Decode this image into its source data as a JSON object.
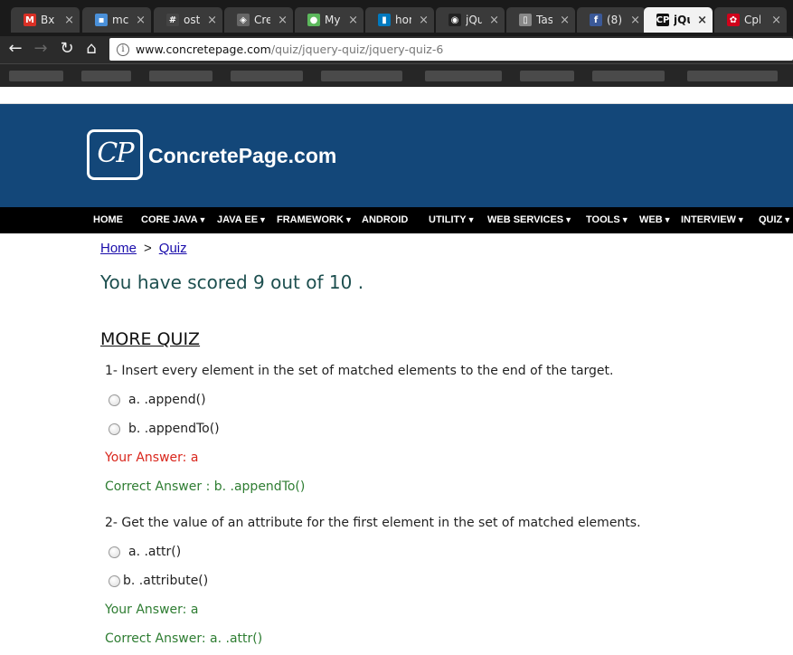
{
  "browser": {
    "tabs": [
      {
        "label": "Bx",
        "favicon": "gmail-icon",
        "color": "#d93025",
        "glyph": "M"
      },
      {
        "label": "mc",
        "favicon": "folder-icon",
        "color": "#4a90d9",
        "glyph": "▪"
      },
      {
        "label": "ost",
        "favicon": "slack-icon",
        "color": "#444444",
        "glyph": "#"
      },
      {
        "label": "Cre",
        "favicon": "cube-icon",
        "color": "#666666",
        "glyph": "◈"
      },
      {
        "label": "My",
        "favicon": "circle-icon",
        "color": "#5cb85c",
        "glyph": "●"
      },
      {
        "label": "hor",
        "favicon": "trello-icon",
        "color": "#0079bf",
        "glyph": "▮"
      },
      {
        "label": "jQu",
        "favicon": "github-icon",
        "color": "#222222",
        "glyph": "◉"
      },
      {
        "label": "Tas",
        "favicon": "document-icon",
        "color": "#888888",
        "glyph": "▯"
      },
      {
        "label": "(8)",
        "favicon": "facebook-icon",
        "color": "#3b5998",
        "glyph": "f"
      },
      {
        "label": "jQu",
        "favicon": "concretepage-icon",
        "color": "#111111",
        "glyph": "CP"
      },
      {
        "label": "Cpl",
        "favicon": "red-badge-icon",
        "color": "#d0021b",
        "glyph": "✿"
      }
    ],
    "active_tab_index": 9,
    "url_host": "www.concretepage.com",
    "url_path": "/quiz/jquery-quiz/jquery-quiz-6"
  },
  "site": {
    "logo_mark": "CP",
    "logo_text": "ConcretePage.com",
    "header_color": "#134779",
    "nav": [
      {
        "label": "HOME",
        "dropdown": false
      },
      {
        "label": "CORE JAVA",
        "dropdown": true
      },
      {
        "label": "JAVA EE",
        "dropdown": true
      },
      {
        "label": "FRAMEWORK",
        "dropdown": true
      },
      {
        "label": "ANDROID",
        "dropdown": false
      },
      {
        "label": "UTILITY",
        "dropdown": true
      },
      {
        "label": "WEB SERVICES",
        "dropdown": true
      },
      {
        "label": "TOOLS",
        "dropdown": true
      },
      {
        "label": "WEB",
        "dropdown": true
      },
      {
        "label": "INTERVIEW",
        "dropdown": true
      },
      {
        "label": "QUIZ",
        "dropdown": true
      }
    ]
  },
  "breadcrumb": {
    "home": "Home",
    "sep": ">",
    "current": "Quiz"
  },
  "score_text": "You have scored 9 out of 10 .",
  "more_quiz_title": "MORE QUIZ",
  "questions": [
    {
      "text": "1- Insert every element in the set of matched elements to the end of the target.",
      "options": [
        "a. .append()",
        "b. .appendTo()"
      ],
      "your_answer": "Your Answer: a",
      "correct_answer": "Correct Answer : b. .appendTo()",
      "your_answer_color": "#d9261c"
    },
    {
      "text": "2- Get the value of an attribute for the first element in the set of matched elements.",
      "options": [
        "a. .attr()",
        "b. .attribute()"
      ],
      "your_answer": "Your Answer: a",
      "correct_answer": "Correct Answer: a. .attr()",
      "your_answer_color": "#2e7d32"
    }
  ]
}
